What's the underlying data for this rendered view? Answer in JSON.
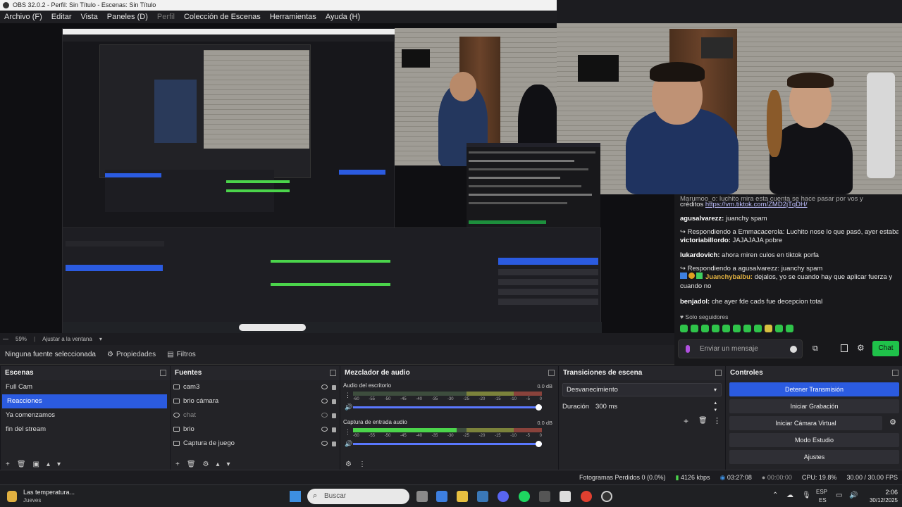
{
  "window": {
    "title": "OBS 32.0.2 - Perfil: Sin Título - Escenas: Sin Título"
  },
  "menu": [
    {
      "label": "Archivo (F)",
      "dim": false
    },
    {
      "label": "Editar",
      "dim": false
    },
    {
      "label": "Vista",
      "dim": false
    },
    {
      "label": "Paneles (D)",
      "dim": false
    },
    {
      "label": "Perfil",
      "dim": true
    },
    {
      "label": "Colección de Escenas",
      "dim": false
    },
    {
      "label": "Herramientas",
      "dim": false
    },
    {
      "label": "Ayuda (H)",
      "dim": false
    }
  ],
  "chat": {
    "partial_line": "Marumoo_o: luchito mira esta cuenta se hace pasar por vos y",
    "credit_prefix": "créditos",
    "link": "https://vm.tiktok.com/ZMD2jTqDH/",
    "messages": [
      {
        "reply": "",
        "user": "agusalvarezz:",
        "text": "juanchy spam"
      },
      {
        "reply": "Respondiendo a Emmacacerola: Luchito nose lo que pasó, ayer estaba vi...",
        "user": "",
        "text": ""
      },
      {
        "reply": "",
        "user": "victoriabillordo:",
        "text": "JAJAJAJA pobre"
      },
      {
        "reply": "",
        "user": "lukardovich:",
        "text": "ahora miren culos en tiktok porfa"
      },
      {
        "reply": "Respondiendo a agusalvarezz: juanchy spam",
        "user": "",
        "text": ""
      },
      {
        "reply": "",
        "user": "Juanchybalbu:",
        "text": "dejalos, yo se cuando hay que aplicar fuerza y cuando no"
      },
      {
        "reply": "",
        "user": "benjadol:",
        "text": "che ayer fde cads fue decepcion total"
      }
    ],
    "followers_only": "Solo seguidores",
    "input_placeholder": "Enviar un mensaje",
    "chat_button": "Chat"
  },
  "zoom": {
    "level": "59%",
    "fit": "Ajustar a la ventana"
  },
  "source_bar": {
    "no_source": "Ninguna fuente seleccionada",
    "properties": "Propiedades",
    "filters": "Filtros"
  },
  "scenes": {
    "title": "Escenas",
    "items": [
      "Full Cam",
      "Reacciones",
      "Ya comenzamos",
      "fin del stream"
    ],
    "selected": 1
  },
  "sources": {
    "title": "Fuentes",
    "items": [
      {
        "name": "cam3",
        "dim": false
      },
      {
        "name": "brio cámara",
        "dim": false
      },
      {
        "name": "chat",
        "dim": true
      },
      {
        "name": "brio",
        "dim": false
      },
      {
        "name": "Captura de juego",
        "dim": false
      }
    ]
  },
  "mixer": {
    "title": "Mezclador de audio",
    "ticks": [
      "-60",
      "-55",
      "-50",
      "-45",
      "-40",
      "-35",
      "-30",
      "-25",
      "-20",
      "-15",
      "-10",
      "-5",
      "0"
    ],
    "channels": [
      {
        "name": "Audio del escritorio",
        "db": "0.0 dB",
        "level": 0.0
      },
      {
        "name": "Captura de entrada audio",
        "db": "0.0 dB",
        "level": 0.55
      }
    ]
  },
  "transitions": {
    "title": "Transiciones de escena",
    "selected": "Desvanecimiento",
    "duration_label": "Duración",
    "duration_value": "300 ms"
  },
  "controls": {
    "title": "Controles",
    "buttons": [
      "Detener Transmisión",
      "Iniciar Grabación",
      "Iniciar Cámara Virtual",
      "Modo Estudio",
      "Ajustes"
    ]
  },
  "status": {
    "dropped": "Fotogramas Perdidos 0 (0.0%)",
    "bitrate": "4126 kbps",
    "stream_time": "03:27:08",
    "rec_time": "00:00:00",
    "cpu": "CPU: 19.8%",
    "fps": "30.00 / 30.00 FPS"
  },
  "taskbar": {
    "weather_title": "Las temperatura...",
    "weather_sub": "Jueves",
    "search": "Buscar",
    "lang": "ESP",
    "lang2": "ES",
    "time": "2:06",
    "date": "30/12/2025"
  },
  "colors": {
    "accent": "#2b5be0",
    "chat_button": "#1fc24a",
    "meter_green": "#4bd44b"
  }
}
